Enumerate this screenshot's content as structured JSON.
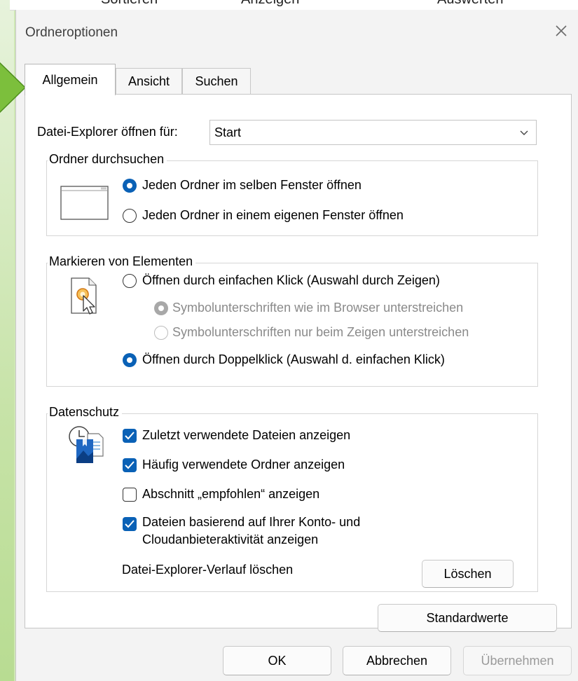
{
  "background_toolbar": {
    "items": [
      "Sortieren",
      "Anzeigen",
      "Auswerten"
    ]
  },
  "dialog": {
    "title": "Ordneroptionen",
    "close_icon": "close-icon"
  },
  "tabs": [
    {
      "label": "Allgemein",
      "active": true
    },
    {
      "label": "Ansicht",
      "active": false
    },
    {
      "label": "Suchen",
      "active": false
    }
  ],
  "general": {
    "open_for_label": "Datei-Explorer öffnen für:",
    "open_for_value": "Start",
    "browse_group": {
      "title": "Ordner durchsuchen",
      "icon": "window-icon",
      "options": [
        {
          "label": "Jeden Ordner im selben Fenster öffnen",
          "selected": true
        },
        {
          "label": "Jeden Ordner in einem eigenen Fenster öffnen",
          "selected": false
        }
      ]
    },
    "click_group": {
      "title": "Markieren von Elementen",
      "icon": "single-click-cursor-icon",
      "single_click": {
        "label": "Öffnen durch einfachen Klick (Auswahl durch Zeigen)",
        "selected": false
      },
      "sub_options": [
        {
          "label": "Symbolunterschriften wie im Browser unterstreichen",
          "selected": true,
          "enabled": false
        },
        {
          "label": "Symbolunterschriften nur beim Zeigen unterstreichen",
          "selected": false,
          "enabled": false
        }
      ],
      "double_click": {
        "label": "Öffnen durch Doppelklick (Auswahl d. einfachen Klick)",
        "selected": true
      }
    },
    "privacy_group": {
      "title": "Datenschutz",
      "icon": "recent-files-icon",
      "checkboxes": [
        {
          "label": "Zuletzt verwendete Dateien anzeigen",
          "checked": true
        },
        {
          "label": "Häufig verwendete Ordner anzeigen",
          "checked": true
        },
        {
          "label": "Abschnitt „empfohlen“ anzeigen",
          "checked": false
        },
        {
          "label_line1": "Dateien basierend auf Ihrer Konto- und",
          "label_line2": "Cloudanbieteraktivität anzeigen",
          "checked": true
        }
      ],
      "clear_history_label": "Datei-Explorer-Verlauf löschen",
      "clear_button": "Löschen"
    },
    "defaults_button": "Standardwerte"
  },
  "footer": {
    "ok": "OK",
    "cancel": "Abbrechen",
    "apply": "Übernehmen"
  },
  "colors": {
    "accent": "#0a61b6",
    "arrow_green": "#7cbf3c",
    "background_green": "#cfe8b4"
  }
}
